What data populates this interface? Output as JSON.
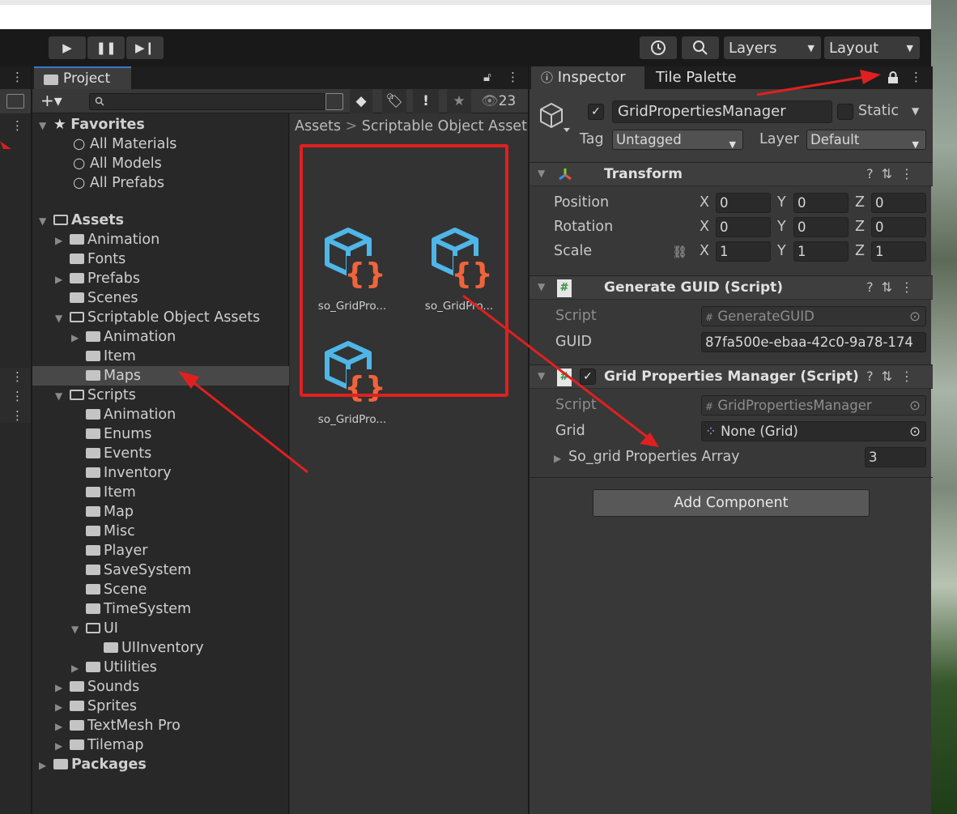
{
  "toolbar": {
    "layers_label": "Layers",
    "layout_label": "Layout"
  },
  "project": {
    "tab_label": "Project",
    "hidden_count": "23",
    "favorites": {
      "label": "Favorites",
      "items": [
        "All Materials",
        "All Models",
        "All Prefabs"
      ]
    },
    "assets_label": "Assets",
    "tree": [
      {
        "label": "Animation",
        "level": 1,
        "expand": "closed"
      },
      {
        "label": "Fonts",
        "level": 1,
        "expand": "none"
      },
      {
        "label": "Prefabs",
        "level": 1,
        "expand": "closed"
      },
      {
        "label": "Scenes",
        "level": 1,
        "expand": "none"
      },
      {
        "label": "Scriptable Object Assets",
        "level": 1,
        "expand": "open"
      },
      {
        "label": "Animation",
        "level": 2,
        "expand": "closed"
      },
      {
        "label": "Item",
        "level": 2,
        "expand": "none"
      },
      {
        "label": "Maps",
        "level": 2,
        "expand": "none",
        "selected": true
      },
      {
        "label": "Scripts",
        "level": 1,
        "expand": "open"
      },
      {
        "label": "Animation",
        "level": 2,
        "expand": "none"
      },
      {
        "label": "Enums",
        "level": 2,
        "expand": "none"
      },
      {
        "label": "Events",
        "level": 2,
        "expand": "none"
      },
      {
        "label": "Inventory",
        "level": 2,
        "expand": "none"
      },
      {
        "label": "Item",
        "level": 2,
        "expand": "none"
      },
      {
        "label": "Map",
        "level": 2,
        "expand": "none"
      },
      {
        "label": "Misc",
        "level": 2,
        "expand": "none"
      },
      {
        "label": "Player",
        "level": 2,
        "expand": "none"
      },
      {
        "label": "SaveSystem",
        "level": 2,
        "expand": "none"
      },
      {
        "label": "Scene",
        "level": 2,
        "expand": "none"
      },
      {
        "label": "TimeSystem",
        "level": 2,
        "expand": "none"
      },
      {
        "label": "UI",
        "level": 2,
        "expand": "open"
      },
      {
        "label": "UIInventory",
        "level": 3,
        "expand": "none"
      },
      {
        "label": "Utilities",
        "level": 2,
        "expand": "closed"
      },
      {
        "label": "Sounds",
        "level": 1,
        "expand": "closed"
      },
      {
        "label": "Sprites",
        "level": 1,
        "expand": "closed"
      },
      {
        "label": "TextMesh Pro",
        "level": 1,
        "expand": "closed"
      },
      {
        "label": "Tilemap",
        "level": 1,
        "expand": "closed"
      }
    ],
    "packages_label": "Packages",
    "breadcrumb": {
      "root": "Assets",
      "current": "Scriptable Object Asset"
    },
    "assets": [
      "so_GridPro...",
      "so_GridPro...",
      "so_GridPro..."
    ]
  },
  "inspector": {
    "tab_inspector": "Inspector",
    "tab_tile_palette": "Tile Palette",
    "object_name": "GridPropertiesManager",
    "static_label": "Static",
    "tag_label": "Tag",
    "tag_value": "Untagged",
    "layer_label": "Layer",
    "layer_value": "Default",
    "transform": {
      "title": "Transform",
      "position_label": "Position",
      "rotation_label": "Rotation",
      "scale_label": "Scale",
      "position": [
        "0",
        "0",
        "0"
      ],
      "rotation": [
        "0",
        "0",
        "0"
      ],
      "scale": [
        "1",
        "1",
        "1"
      ],
      "axis": [
        "X",
        "Y",
        "Z"
      ]
    },
    "generate_guid": {
      "title": "Generate GUID (Script)",
      "script_label": "Script",
      "script_value": "GenerateGUID",
      "guid_label": "GUID",
      "guid_value": "87fa500e-ebaa-42c0-9a78-174"
    },
    "grid_props": {
      "title": "Grid Properties Manager (Script)",
      "script_label": "Script",
      "script_value": "GridPropertiesManager",
      "grid_label": "Grid",
      "grid_value": "None (Grid)",
      "array_label": "So_grid Properties Array",
      "array_size": "3"
    },
    "add_component": "Add Component"
  },
  "colors": {
    "annotation_red": "#e02020",
    "accent_blue": "#3a78c8",
    "cube_blue": "#4fb6e8",
    "brace_orange": "#f0643c"
  }
}
